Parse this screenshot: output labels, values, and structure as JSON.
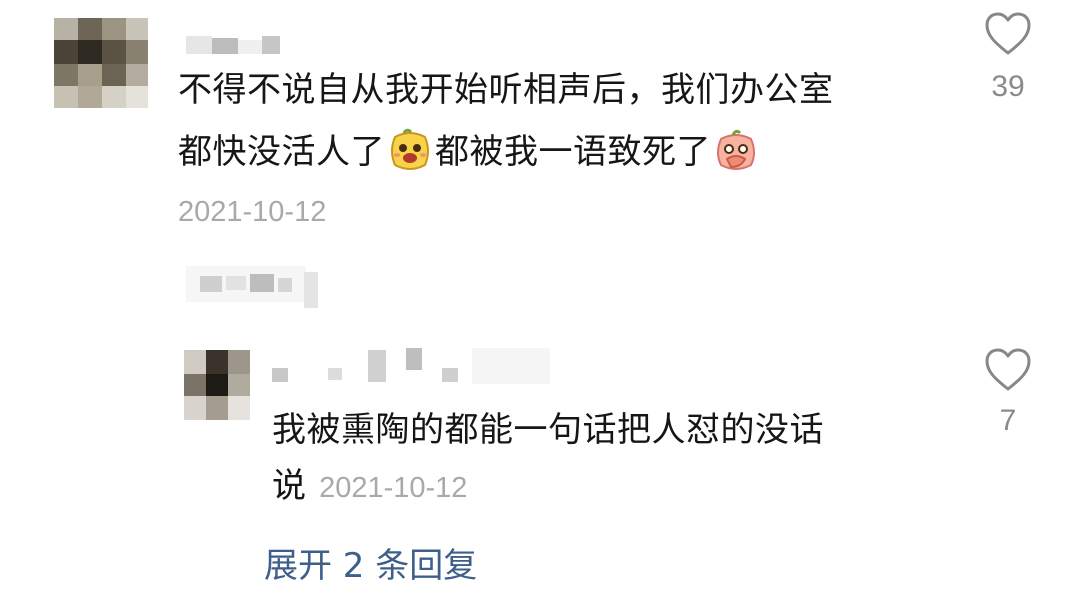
{
  "comment": {
    "line1": "不得不说自从我开始听相声后，我们办公室",
    "line2_part1": "都快没活人了",
    "line2_part2": "都被我一语致死了",
    "date": "2021-10-12",
    "likes": "39",
    "emoji1": "laughing-face-emoji",
    "emoji2": "covering-mouth-laugh-emoji"
  },
  "reply": {
    "line1": "我被熏陶的都能一句话把人怼的没话",
    "line2": "说",
    "date": "2021-10-12",
    "likes": "7"
  },
  "expand_replies": "展开 2 条回复",
  "colors": {
    "link": "#3e5f8a",
    "date": "#a9a9a9",
    "count": "#8a8a8a"
  }
}
